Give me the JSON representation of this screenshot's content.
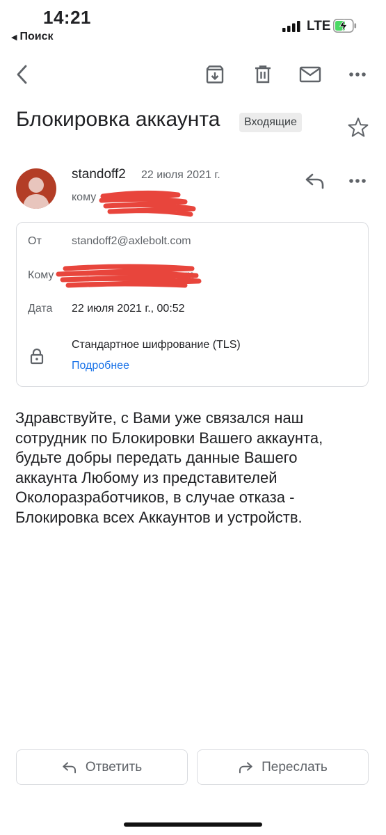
{
  "status_bar": {
    "time": "14:21",
    "back_app": "Поиск",
    "network": "LTE"
  },
  "toolbar": {
    "icons": [
      "back-arrow-icon",
      "archive-icon",
      "delete-icon",
      "mark-unread-icon",
      "more-icon"
    ]
  },
  "subject": {
    "title": "Блокировка аккаунта",
    "label": "Входящие"
  },
  "sender": {
    "name": "standoff2",
    "date": "22 июля 2021 г.",
    "to_prefix": "кому"
  },
  "details": {
    "from_label": "От",
    "from_value": "standoff2@axlebolt.com",
    "to_label": "Кому",
    "to_visible_tail": "om",
    "date_label": "Дата",
    "date_value": "22 июля 2021 г., 00:52",
    "encryption": "Стандартное шифрование (TLS)",
    "more_link": "Подробнее"
  },
  "body": "Здравствуйте, с Вами уже связался наш\nсотрудник по Блокировки Вашего аккаунта,\nбудьте добры передать данные Вашего\nаккаунта Любому из представителей\nОколоразработчиков, в случае отказа -\nБлокировка всех Аккаунтов и устройств.",
  "actions": {
    "reply": "Ответить",
    "forward": "Переслать"
  },
  "colors": {
    "accent_link": "#1a73e8",
    "avatar_bg": "#b33d26",
    "redaction": "#e8453c",
    "battery_charge": "#4cd964"
  }
}
